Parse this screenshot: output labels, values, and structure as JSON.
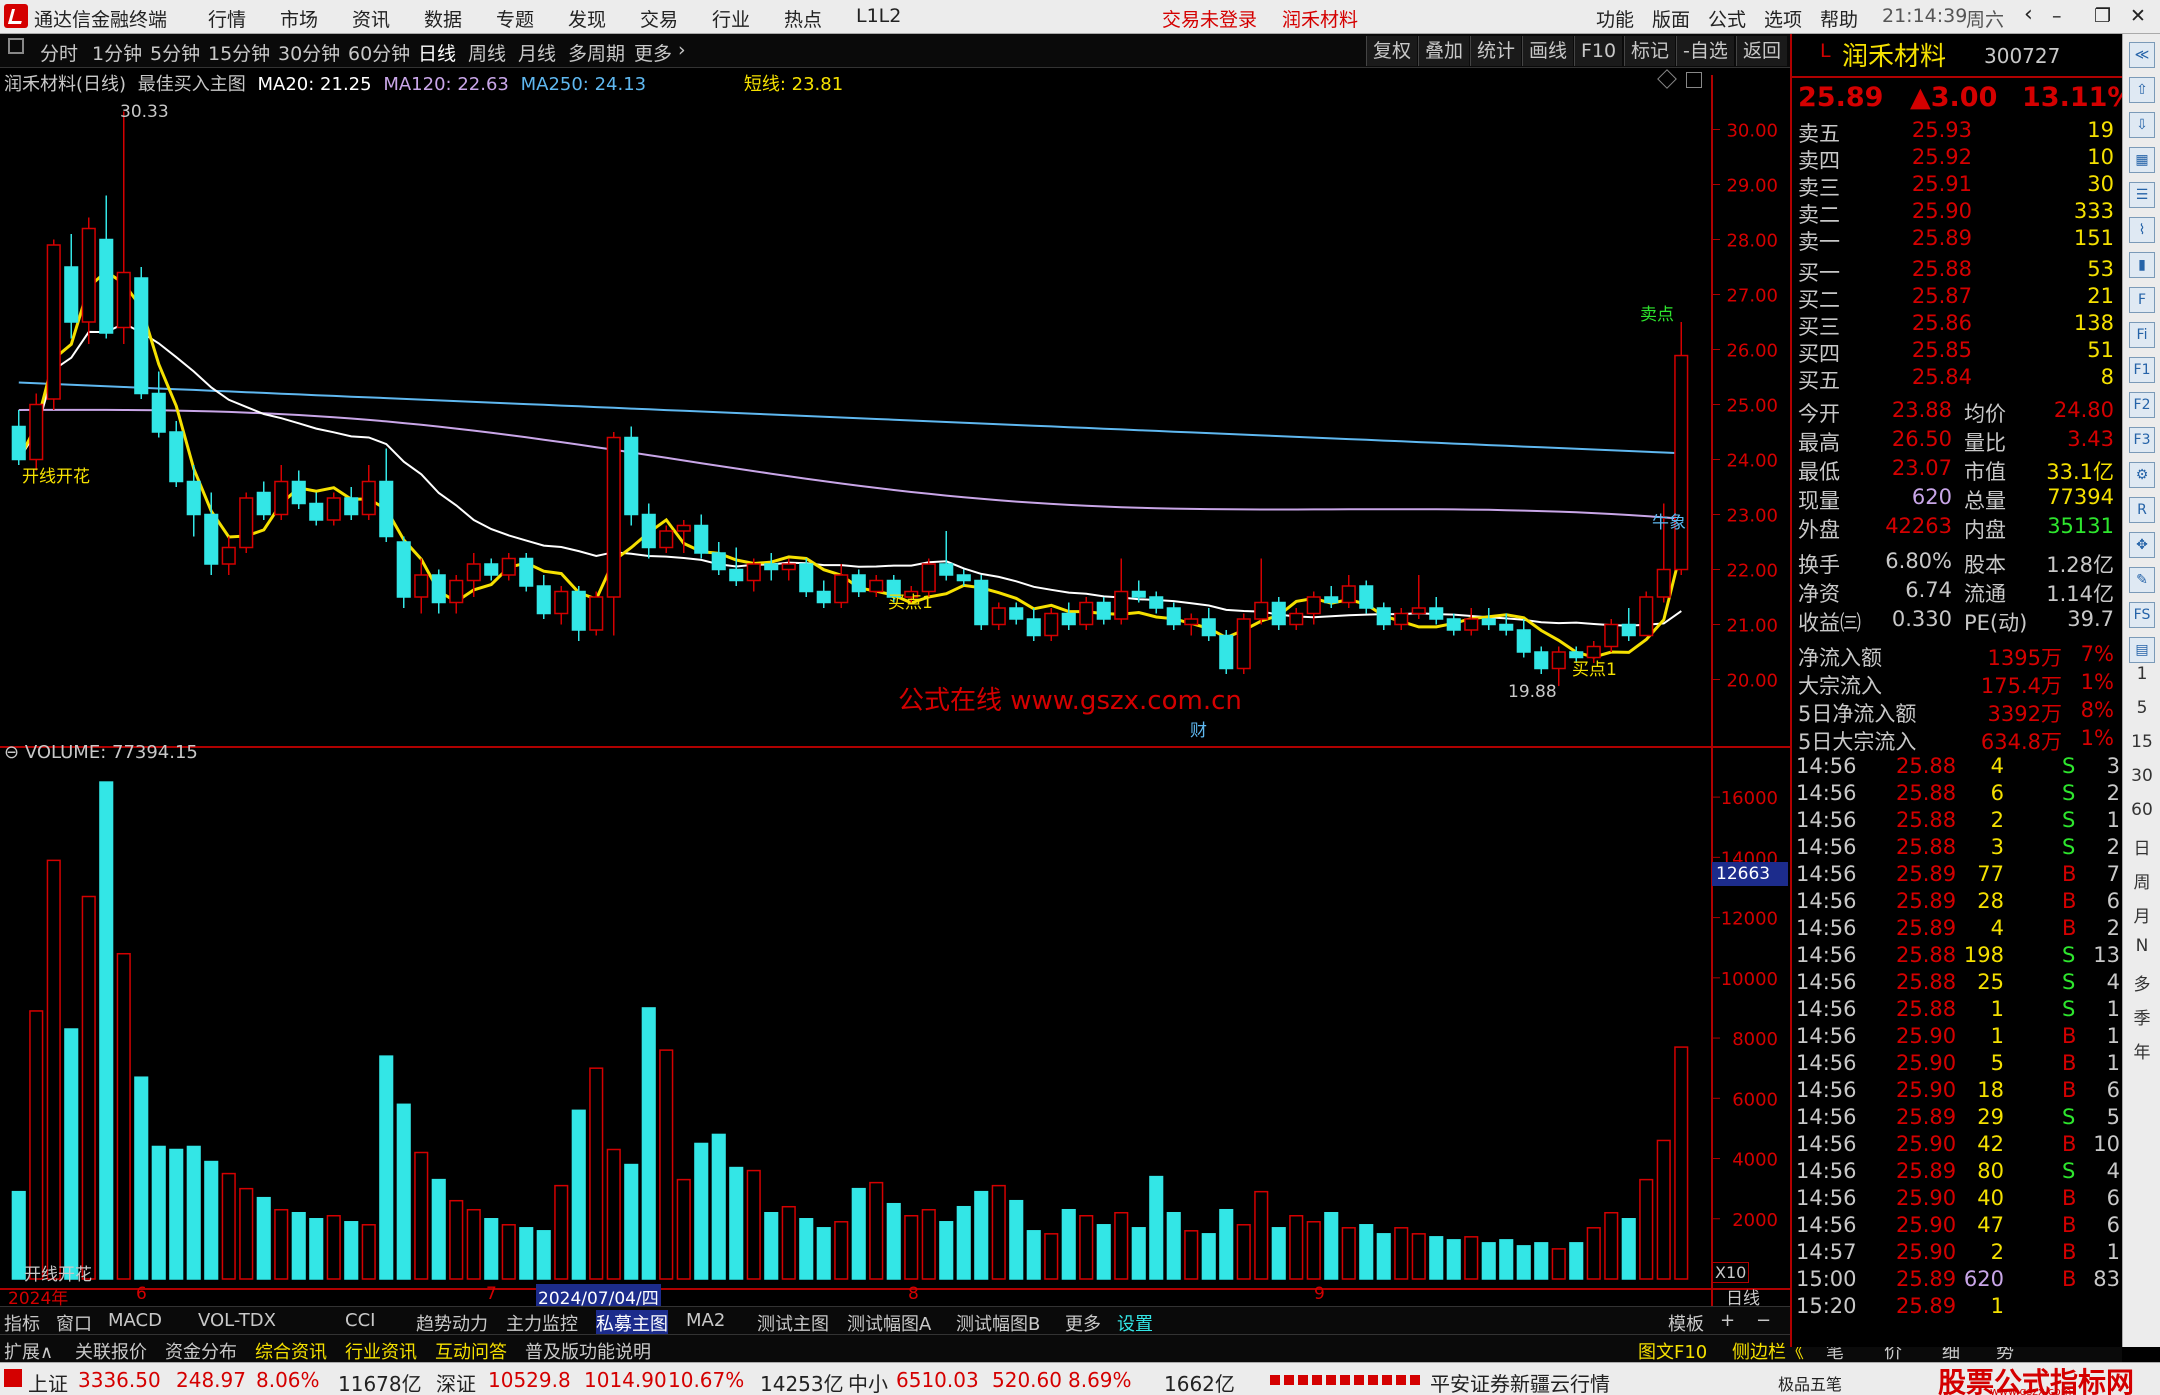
{
  "menubar": {
    "app_title": "通达信金融终端",
    "items": [
      "行情",
      "市场",
      "资讯",
      "数据",
      "专题",
      "发现",
      "交易",
      "行业",
      "热点",
      "L1L2"
    ],
    "notice": "交易未登录",
    "stock_name": "润禾材料",
    "right_items": [
      "功能",
      "版面",
      "公式",
      "选项",
      "帮助"
    ],
    "time": "21:14:39",
    "weekday": "周六"
  },
  "toolbar": {
    "periods": [
      "分时",
      "1分钟",
      "5分钟",
      "15分钟",
      "30分钟",
      "60分钟",
      "日线",
      "周线",
      "月线",
      "多周期",
      "更多"
    ],
    "active_period": "日线",
    "right_buttons": [
      "复权",
      "叠加",
      "统计",
      "画线",
      "F10",
      "标记",
      "-自选",
      "返回"
    ]
  },
  "main_chart": {
    "header": {
      "name": "润禾材料(日线)",
      "formula": "最佳买入主图",
      "ma20": "MA20: 21.25",
      "ma120": "MA120: 22.63",
      "ma250": "MA250: 24.13",
      "short_line": "短线: 23.81"
    },
    "y_ticks": [
      "30.00",
      "29.00",
      "28.00",
      "27.00",
      "26.00",
      "25.00",
      "24.00",
      "23.00",
      "22.00",
      "21.00",
      "20.00"
    ],
    "price_min": 19.5,
    "price_max": 30.5,
    "annotations": {
      "high": "30.33",
      "low": "19.88",
      "left_label": "开线开花",
      "sell_top": "卖点",
      "right_label": "牛象",
      "buy1a": "买点1",
      "buy1b": "买点1",
      "cai": "财",
      "watermark": "公式在线  www.gszx.com.cn"
    }
  },
  "candles": [
    [
      24.6,
      24.9,
      23.9,
      24.0
    ],
    [
      24.0,
      25.2,
      23.8,
      25.0
    ],
    [
      25.1,
      28.0,
      24.9,
      27.9
    ],
    [
      27.5,
      28.1,
      26.2,
      26.5
    ],
    [
      26.5,
      28.4,
      26.1,
      28.2
    ],
    [
      28.0,
      28.8,
      26.2,
      26.3
    ],
    [
      26.4,
      30.33,
      26.1,
      27.4
    ],
    [
      27.3,
      27.5,
      25.1,
      25.2
    ],
    [
      25.2,
      25.6,
      24.4,
      24.5
    ],
    [
      24.5,
      24.7,
      23.5,
      23.6
    ],
    [
      23.6,
      23.9,
      22.6,
      23.0
    ],
    [
      23.0,
      23.4,
      21.9,
      22.1
    ],
    [
      22.1,
      22.6,
      21.9,
      22.4
    ],
    [
      22.4,
      23.4,
      22.3,
      23.3
    ],
    [
      23.4,
      23.6,
      22.9,
      23.0
    ],
    [
      23.0,
      23.9,
      22.9,
      23.6
    ],
    [
      23.6,
      23.8,
      23.1,
      23.2
    ],
    [
      23.2,
      23.4,
      22.8,
      22.9
    ],
    [
      22.9,
      23.4,
      22.8,
      23.3
    ],
    [
      23.3,
      23.5,
      22.9,
      23.0
    ],
    [
      23.0,
      23.9,
      22.9,
      23.6
    ],
    [
      23.6,
      24.2,
      22.5,
      22.6
    ],
    [
      22.5,
      22.6,
      21.3,
      21.5
    ],
    [
      21.5,
      22.2,
      21.2,
      21.9
    ],
    [
      21.9,
      22.0,
      21.2,
      21.4
    ],
    [
      21.4,
      21.9,
      21.2,
      21.8
    ],
    [
      21.8,
      22.3,
      21.5,
      22.1
    ],
    [
      22.1,
      22.2,
      21.8,
      21.9
    ],
    [
      21.9,
      22.3,
      21.8,
      22.2
    ],
    [
      22.2,
      22.3,
      21.6,
      21.7
    ],
    [
      21.7,
      21.9,
      21.1,
      21.2
    ],
    [
      21.2,
      21.7,
      21.0,
      21.6
    ],
    [
      21.6,
      21.7,
      20.7,
      20.9
    ],
    [
      20.9,
      21.6,
      20.8,
      21.5
    ],
    [
      21.5,
      24.5,
      20.8,
      24.4
    ],
    [
      24.4,
      24.6,
      22.8,
      23.0
    ],
    [
      23.0,
      23.2,
      22.2,
      22.4
    ],
    [
      22.4,
      22.8,
      22.3,
      22.7
    ],
    [
      22.7,
      22.9,
      22.3,
      22.8
    ],
    [
      22.8,
      23.0,
      22.2,
      22.3
    ],
    [
      22.3,
      22.5,
      21.9,
      22.0
    ],
    [
      22.0,
      22.4,
      21.7,
      21.8
    ],
    [
      21.8,
      22.2,
      21.6,
      22.1
    ],
    [
      22.1,
      22.3,
      21.8,
      22.0
    ],
    [
      22.0,
      22.2,
      21.8,
      22.1
    ],
    [
      22.1,
      22.2,
      21.5,
      21.6
    ],
    [
      21.6,
      21.8,
      21.3,
      21.4
    ],
    [
      21.4,
      22.1,
      21.3,
      21.9
    ],
    [
      21.9,
      22.0,
      21.5,
      21.6
    ],
    [
      21.6,
      21.9,
      21.5,
      21.8
    ],
    [
      21.8,
      21.9,
      21.4,
      21.5
    ],
    [
      21.5,
      21.7,
      21.4,
      21.6
    ],
    [
      21.6,
      22.2,
      21.5,
      22.1
    ],
    [
      22.1,
      22.7,
      21.8,
      21.9
    ],
    [
      21.9,
      22.0,
      21.7,
      21.8
    ],
    [
      21.8,
      21.9,
      20.9,
      21.0
    ],
    [
      21.0,
      21.4,
      20.9,
      21.3
    ],
    [
      21.3,
      21.4,
      21.0,
      21.1
    ],
    [
      21.1,
      21.3,
      20.7,
      20.8
    ],
    [
      20.8,
      21.3,
      20.7,
      21.2
    ],
    [
      21.2,
      21.4,
      20.9,
      21.0
    ],
    [
      21.0,
      21.5,
      20.9,
      21.4
    ],
    [
      21.4,
      21.5,
      21.0,
      21.1
    ],
    [
      21.1,
      22.2,
      21.0,
      21.6
    ],
    [
      21.6,
      21.8,
      21.4,
      21.5
    ],
    [
      21.5,
      21.6,
      21.2,
      21.3
    ],
    [
      21.3,
      21.4,
      20.9,
      21.0
    ],
    [
      21.0,
      21.2,
      20.8,
      21.1
    ],
    [
      21.1,
      21.3,
      20.7,
      20.8
    ],
    [
      20.8,
      20.9,
      20.1,
      20.2
    ],
    [
      20.2,
      21.2,
      20.1,
      21.1
    ],
    [
      21.1,
      22.2,
      21.0,
      21.4
    ],
    [
      21.4,
      21.5,
      20.9,
      21.0
    ],
    [
      21.0,
      21.3,
      20.9,
      21.2
    ],
    [
      21.2,
      21.6,
      21.0,
      21.5
    ],
    [
      21.5,
      21.7,
      21.3,
      21.4
    ],
    [
      21.4,
      21.9,
      21.3,
      21.7
    ],
    [
      21.7,
      21.8,
      21.2,
      21.3
    ],
    [
      21.3,
      21.4,
      20.9,
      21.0
    ],
    [
      21.0,
      21.3,
      20.9,
      21.2
    ],
    [
      21.2,
      21.9,
      21.1,
      21.3
    ],
    [
      21.3,
      21.5,
      21.0,
      21.1
    ],
    [
      21.1,
      21.2,
      20.8,
      20.9
    ],
    [
      20.9,
      21.3,
      20.8,
      21.1
    ],
    [
      21.1,
      21.3,
      20.9,
      21.0
    ],
    [
      21.0,
      21.2,
      20.8,
      20.9
    ],
    [
      20.9,
      21.1,
      20.4,
      20.5
    ],
    [
      20.5,
      20.6,
      20.1,
      20.2
    ],
    [
      20.2,
      20.6,
      19.88,
      20.5
    ],
    [
      20.5,
      20.6,
      20.3,
      20.4
    ],
    [
      20.4,
      20.7,
      20.3,
      20.6
    ],
    [
      20.6,
      21.1,
      20.5,
      21.0
    ],
    [
      21.0,
      21.3,
      20.7,
      20.8
    ],
    [
      20.8,
      21.6,
      20.8,
      21.5
    ],
    [
      21.5,
      23.2,
      21.4,
      22.0
    ],
    [
      22.0,
      26.5,
      21.9,
      25.89
    ]
  ],
  "volume": {
    "header": "VOLUME: 77394.15",
    "y_ticks": [
      "16000",
      "14000",
      "12000",
      "10000",
      "8000",
      "6000",
      "4000",
      "2000"
    ],
    "marker": "12663",
    "x10": "X10",
    "values": [
      2900,
      8900,
      13900,
      8300,
      12700,
      16500,
      10800,
      6700,
      4400,
      4300,
      4400,
      3900,
      3500,
      3000,
      2700,
      2300,
      2200,
      2000,
      2100,
      1900,
      1800,
      7400,
      5800,
      4200,
      3300,
      2600,
      2300,
      2000,
      1800,
      1700,
      1600,
      3100,
      5600,
      7000,
      4300,
      3800,
      9000,
      7600,
      3300,
      4500,
      4800,
      3700,
      3600,
      2200,
      2400,
      2000,
      1700,
      1900,
      3000,
      3200,
      2500,
      2100,
      2300,
      1900,
      2400,
      2900,
      3100,
      2600,
      1600,
      1500,
      2300,
      2100,
      1800,
      2200,
      1700,
      3400,
      2200,
      1600,
      1500,
      2300,
      1800,
      2900,
      1700,
      2100,
      1900,
      2200,
      1700,
      1800,
      1500,
      1700,
      1500,
      1400,
      1300,
      1400,
      1200,
      1300,
      1100,
      1200,
      1000,
      1200,
      1700,
      2200,
      2000,
      3300,
      4600,
      7700
    ]
  },
  "x_axis": {
    "labels": [
      "2024年",
      "6",
      "7",
      "2024/07/04/四",
      "8",
      "9"
    ],
    "period": "日线"
  },
  "bottom_tabs1": [
    "指标",
    "窗口",
    "MACD",
    "VOL-TDX",
    "CCI",
    "趋势动力",
    "主力监控",
    "私募主图",
    "MA2",
    "测试主图",
    "测试幅图A",
    "测试幅图B",
    "更多",
    "设置"
  ],
  "bottom_tabs1_right": [
    "模板",
    "+",
    "−"
  ],
  "bottom_tabs2": [
    "扩展∧",
    "关联报价",
    "资金分布",
    "综合资讯",
    "行业资讯",
    "互动问答",
    "普及版功能说明"
  ],
  "bottom_tabs2_right": [
    "图文F10",
    "侧边栏《",
    "笔",
    "价",
    "细",
    "势"
  ],
  "quote": {
    "name": "润禾材料",
    "code": "300727",
    "price": "25.89",
    "change": "▲3.00",
    "pct": "13.11%",
    "asks": [
      [
        "卖五",
        "25.93",
        "19"
      ],
      [
        "卖四",
        "25.92",
        "10"
      ],
      [
        "卖三",
        "25.91",
        "30"
      ],
      [
        "卖二",
        "25.90",
        "333"
      ],
      [
        "卖一",
        "25.89",
        "151"
      ]
    ],
    "bids": [
      [
        "买一",
        "25.88",
        "53"
      ],
      [
        "买二",
        "25.87",
        "21"
      ],
      [
        "买三",
        "25.86",
        "138"
      ],
      [
        "买四",
        "25.85",
        "51"
      ],
      [
        "买五",
        "25.84",
        "8"
      ]
    ],
    "stats": [
      [
        "今开",
        "23.88",
        "均价",
        "24.80"
      ],
      [
        "最高",
        "26.50",
        "量比",
        "3.43"
      ],
      [
        "最低",
        "23.07",
        "市值",
        "33.1亿"
      ],
      [
        "现量",
        "620",
        "总量",
        "77394"
      ],
      [
        "外盘",
        "42263",
        "内盘",
        "35131"
      ]
    ],
    "fin": [
      [
        "换手",
        "6.80%",
        "股本",
        "1.28亿"
      ],
      [
        "净资",
        "6.74",
        "流通",
        "1.14亿"
      ],
      [
        "收益㈢",
        "0.330",
        "PE(动)",
        "39.7"
      ]
    ],
    "flow": [
      [
        "净流入额",
        "1395万",
        "7%"
      ],
      [
        "大宗流入",
        "175.4万",
        "1%"
      ],
      [
        "5日净流入额",
        "3392万",
        "8%"
      ],
      [
        "5日大宗流入",
        "634.8万",
        "1%"
      ]
    ],
    "ticks": [
      [
        "14:56",
        "25.88",
        "4",
        "S",
        "3"
      ],
      [
        "14:56",
        "25.88",
        "6",
        "S",
        "2"
      ],
      [
        "14:56",
        "25.88",
        "2",
        "S",
        "1"
      ],
      [
        "14:56",
        "25.88",
        "3",
        "S",
        "2"
      ],
      [
        "14:56",
        "25.89",
        "77",
        "B",
        "7"
      ],
      [
        "14:56",
        "25.89",
        "28",
        "B",
        "6"
      ],
      [
        "14:56",
        "25.89",
        "4",
        "B",
        "2"
      ],
      [
        "14:56",
        "25.88",
        "198",
        "S",
        "13"
      ],
      [
        "14:56",
        "25.88",
        "25",
        "S",
        "4"
      ],
      [
        "14:56",
        "25.88",
        "1",
        "S",
        "1"
      ],
      [
        "14:56",
        "25.90",
        "1",
        "B",
        "1"
      ],
      [
        "14:56",
        "25.90",
        "5",
        "B",
        "1"
      ],
      [
        "14:56",
        "25.90",
        "18",
        "B",
        "6"
      ],
      [
        "14:56",
        "25.89",
        "29",
        "S",
        "5"
      ],
      [
        "14:56",
        "25.90",
        "42",
        "B",
        "10"
      ],
      [
        "14:56",
        "25.89",
        "80",
        "S",
        "4"
      ],
      [
        "14:56",
        "25.90",
        "40",
        "B",
        "6"
      ],
      [
        "14:56",
        "25.90",
        "47",
        "B",
        "6"
      ],
      [
        "14:57",
        "25.90",
        "2",
        "B",
        "1"
      ],
      [
        "15:00",
        "25.89",
        "620",
        "B",
        "83"
      ],
      [
        "15:20",
        "25.89",
        "1",
        "",
        ""
      ]
    ]
  },
  "sidebar": {
    "icons": [
      "collapse-icon",
      "up-icon",
      "down-icon",
      "grid-icon",
      "list-icon",
      "line-chart-icon",
      "candle-icon",
      "f10-icon",
      "fi-icon",
      "f1-icon",
      "f2-icon",
      "f3-icon",
      "tool-icon",
      "rsi-icon",
      "compass-icon",
      "pen-icon",
      "fs-icon",
      "chart2-icon"
    ],
    "periods": [
      "1",
      "5",
      "15",
      "30",
      "60",
      "日",
      "周",
      "月",
      "N",
      "多",
      "季",
      "年"
    ]
  },
  "statusbar": {
    "sh_label": "上证",
    "sh_value": "3336.50",
    "sh_change": "248.97",
    "sh_pct": "8.06%",
    "sh_amount": "11678亿",
    "sz_label": "深证",
    "sz_value": "10529.8",
    "sz_change": "1014.90",
    "sz_pct": "10.67%",
    "sz_amount": "14253亿",
    "zx_label": "中小",
    "zx_value": "6510.03",
    "zx_change": "520.60",
    "zx_pct": "8.69%",
    "zx_amount": "1662亿",
    "broker": "平安证券新疆云行情",
    "corner_logo": "股票公式指标网",
    "corner_url": "www.gszx.com",
    "extra": "极品五笔"
  }
}
